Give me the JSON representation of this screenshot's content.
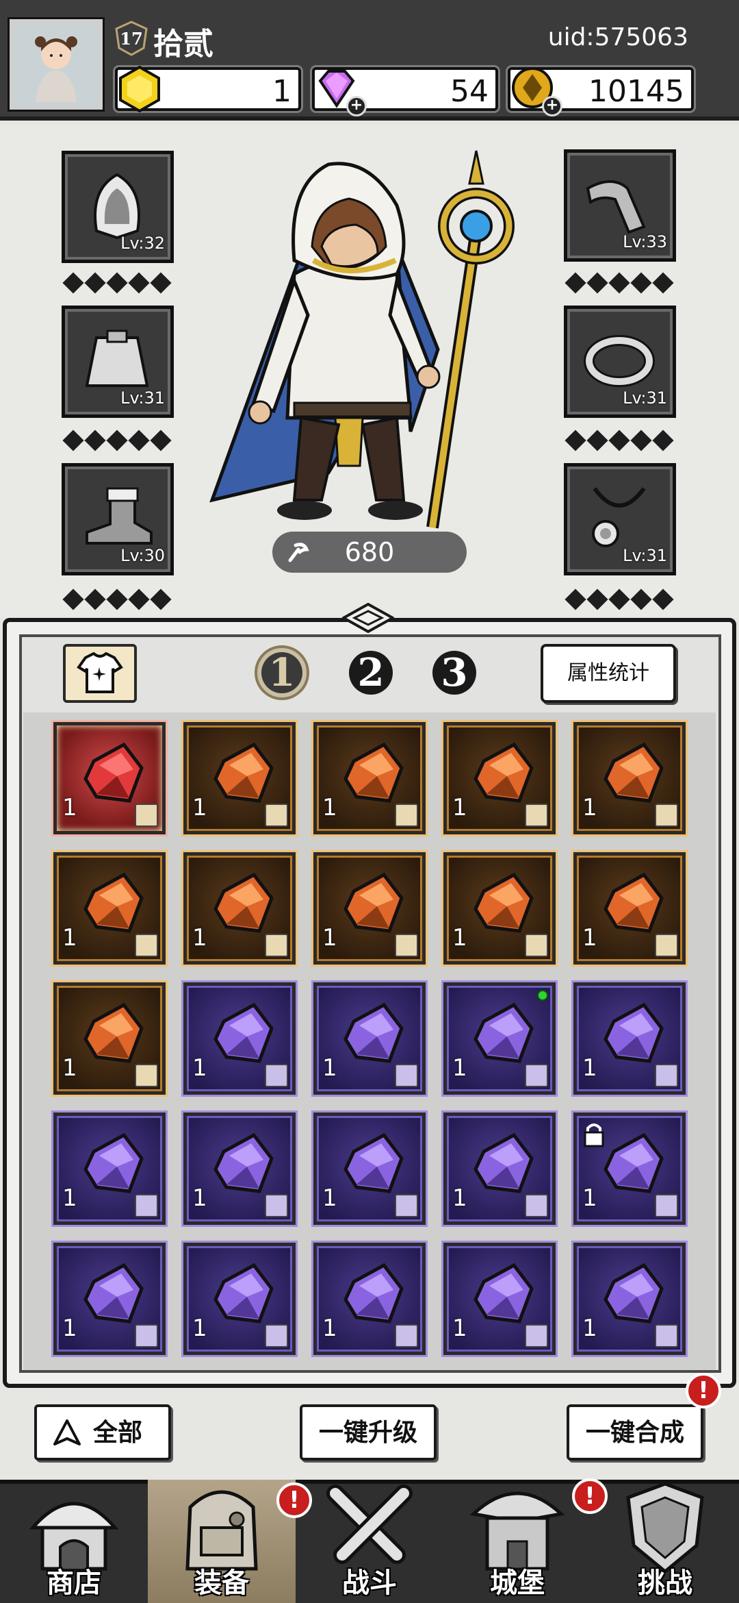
{
  "player": {
    "level": "17",
    "name": "拾贰",
    "uid": "uid:575063"
  },
  "resources": [
    {
      "name": "hexagon-token",
      "value": "1",
      "color": "#f2d21a",
      "has_plus": false
    },
    {
      "name": "diamond",
      "value": "54",
      "color": "#c56cf0",
      "has_plus": true
    },
    {
      "name": "gold-coin",
      "value": "10145",
      "color": "#e0a81a",
      "has_plus": true
    }
  ],
  "equipment": {
    "left": [
      {
        "slot": "hood",
        "level": "Lv:32"
      },
      {
        "slot": "cape",
        "level": "Lv:31"
      },
      {
        "slot": "boots",
        "level": "Lv:30"
      }
    ],
    "right": [
      {
        "slot": "bracer",
        "level": "Lv:33"
      },
      {
        "slot": "ring",
        "level": "Lv:31"
      },
      {
        "slot": "necklace",
        "level": "Lv:31"
      }
    ],
    "power": "680"
  },
  "inventory": {
    "pages": [
      "1",
      "2",
      "3"
    ],
    "active_page": "1",
    "stats_button": "属性统计",
    "items": [
      {
        "rarity": "red",
        "count": "1",
        "slot": "necklace"
      },
      {
        "rarity": "orange",
        "count": "1",
        "slot": "ring"
      },
      {
        "rarity": "orange",
        "count": "1",
        "slot": "ring"
      },
      {
        "rarity": "orange",
        "count": "1",
        "slot": "ring"
      },
      {
        "rarity": "orange",
        "count": "1",
        "slot": "cape"
      },
      {
        "rarity": "orange",
        "count": "1",
        "slot": "boots"
      },
      {
        "rarity": "orange",
        "count": "1",
        "slot": "boots"
      },
      {
        "rarity": "orange",
        "count": "1",
        "slot": "staff"
      },
      {
        "rarity": "orange",
        "count": "1",
        "slot": "staff"
      },
      {
        "rarity": "orange",
        "count": "1",
        "slot": "hood"
      },
      {
        "rarity": "orange",
        "count": "1",
        "slot": "necklace"
      },
      {
        "rarity": "purple",
        "count": "1",
        "slot": "ring"
      },
      {
        "rarity": "purple",
        "count": "1",
        "slot": "ring"
      },
      {
        "rarity": "purple",
        "count": "1",
        "slot": "ring",
        "new": true
      },
      {
        "rarity": "purple",
        "count": "1",
        "slot": "cape"
      },
      {
        "rarity": "purple",
        "count": "1",
        "slot": "cape"
      },
      {
        "rarity": "purple",
        "count": "1",
        "slot": "cape"
      },
      {
        "rarity": "purple",
        "count": "1",
        "slot": "cape"
      },
      {
        "rarity": "purple",
        "count": "1",
        "slot": "cape"
      },
      {
        "rarity": "purple",
        "count": "1",
        "slot": "cape",
        "locked": true
      },
      {
        "rarity": "purple",
        "count": "1",
        "slot": "boots"
      },
      {
        "rarity": "purple",
        "count": "1",
        "slot": "boots"
      },
      {
        "rarity": "purple",
        "count": "1",
        "slot": "boots"
      },
      {
        "rarity": "purple",
        "count": "1",
        "slot": "boots"
      },
      {
        "rarity": "purple",
        "count": "1",
        "slot": "boots"
      }
    ]
  },
  "actions": {
    "all": "全部",
    "upgrade": "一键升级",
    "merge": "一键合成"
  },
  "nav": [
    {
      "label": "商店",
      "icon": "shop-icon",
      "active": false,
      "alert": false
    },
    {
      "label": "装备",
      "icon": "backpack-icon",
      "active": true,
      "alert": true
    },
    {
      "label": "战斗",
      "icon": "crossed-swords-icon",
      "active": false,
      "alert": false
    },
    {
      "label": "城堡",
      "icon": "castle-icon",
      "active": false,
      "alert": true
    },
    {
      "label": "挑战",
      "icon": "shield-icon",
      "active": false,
      "alert": false
    }
  ],
  "colors": {
    "red_rarity": "#b52828",
    "orange_rarity": "#e06a2a",
    "purple_rarity": "#7a5ad0",
    "alert": "#c81e1e"
  }
}
